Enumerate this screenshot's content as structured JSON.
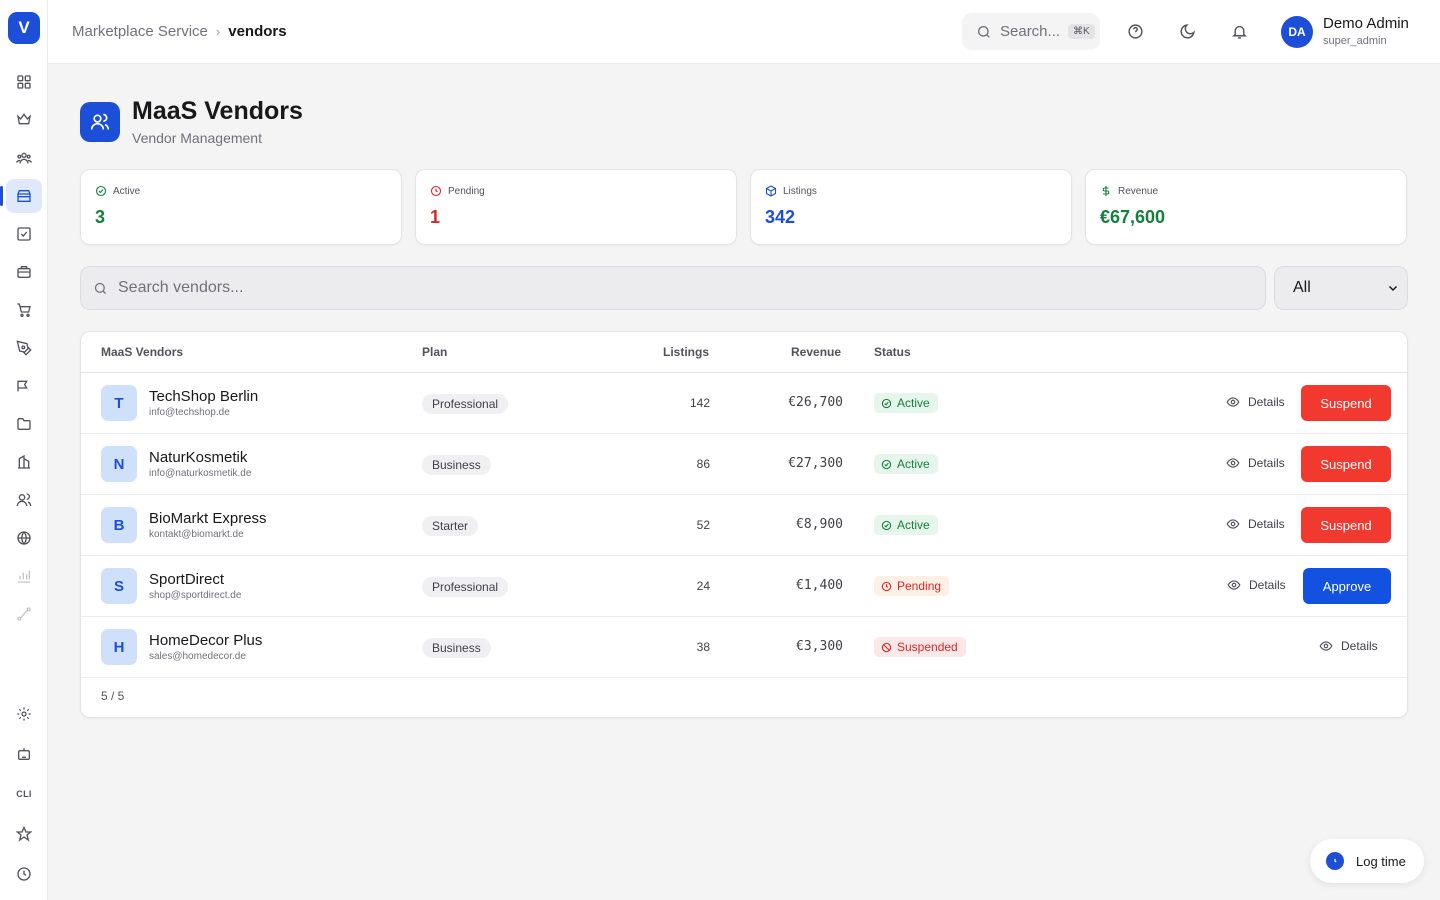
{
  "sidebar": {
    "logo": "V",
    "cli_label": "CLI",
    "icons": [
      "dashboard-icon",
      "crown-icon",
      "users-group-icon",
      "store-icon",
      "checkbox-icon",
      "briefcase-icon",
      "cart-icon",
      "pen-tool-icon",
      "megaphone-icon",
      "folder-icon",
      "building-icon",
      "people-icon",
      "globe-icon",
      "bar-chart-icon",
      "route-icon",
      "settings-icon",
      "robot-icon",
      "cli-icon",
      "star-icon",
      "clock-icon"
    ]
  },
  "header": {
    "breadcrumb_parent": "Marketplace Service",
    "breadcrumb_current": "vendors",
    "search_placeholder": "Search...",
    "search_shortcut": "⌘K",
    "user_initials": "DA",
    "user_name": "Demo Admin",
    "user_role": "super_admin"
  },
  "page": {
    "title": "MaaS Vendors",
    "subtitle": "Vendor Management"
  },
  "stats": [
    {
      "label": "Active",
      "value": "3",
      "color": "#15803d",
      "icon": "check-circle-icon"
    },
    {
      "label": "Pending",
      "value": "1",
      "color": "#dc2626",
      "icon": "clock-icon"
    },
    {
      "label": "Listings",
      "value": "342",
      "color": "#1d4ed8",
      "icon": "package-icon"
    },
    {
      "label": "Revenue",
      "value": "€67,600",
      "color": "#15803d",
      "icon": "dollar-icon"
    }
  ],
  "search": {
    "placeholder": "Search vendors...",
    "filter_value": "All"
  },
  "table": {
    "headers": {
      "vendor": "MaaS Vendors",
      "plan": "Plan",
      "listings": "Listings",
      "revenue": "Revenue",
      "status": "Status"
    },
    "rows": [
      {
        "initial": "T",
        "name": "TechShop Berlin",
        "email": "info@techshop.de",
        "plan": "Professional",
        "listings": "142",
        "revenue": "€26,700",
        "status": "Active",
        "details": "Details",
        "action": "Suspend"
      },
      {
        "initial": "N",
        "name": "NaturKosmetik",
        "email": "info@naturkosmetik.de",
        "plan": "Business",
        "listings": "86",
        "revenue": "€27,300",
        "status": "Active",
        "details": "Details",
        "action": "Suspend"
      },
      {
        "initial": "B",
        "name": "BioMarkt Express",
        "email": "kontakt@biomarkt.de",
        "plan": "Starter",
        "listings": "52",
        "revenue": "€8,900",
        "status": "Active",
        "details": "Details",
        "action": "Suspend"
      },
      {
        "initial": "S",
        "name": "SportDirect",
        "email": "shop@sportdirect.de",
        "plan": "Professional",
        "listings": "24",
        "revenue": "€1,400",
        "status": "Pending",
        "details": "Details",
        "action": "Approve"
      },
      {
        "initial": "H",
        "name": "HomeDecor Plus",
        "email": "sales@homedecor.de",
        "plan": "Business",
        "listings": "38",
        "revenue": "€3,300",
        "status": "Suspended",
        "details": "Details",
        "action": ""
      }
    ],
    "count": "5 / 5"
  },
  "log_time": "Log time",
  "colors": {
    "accent": "#1d4ed8",
    "danger": "#f2392f",
    "success": "#15803d"
  }
}
